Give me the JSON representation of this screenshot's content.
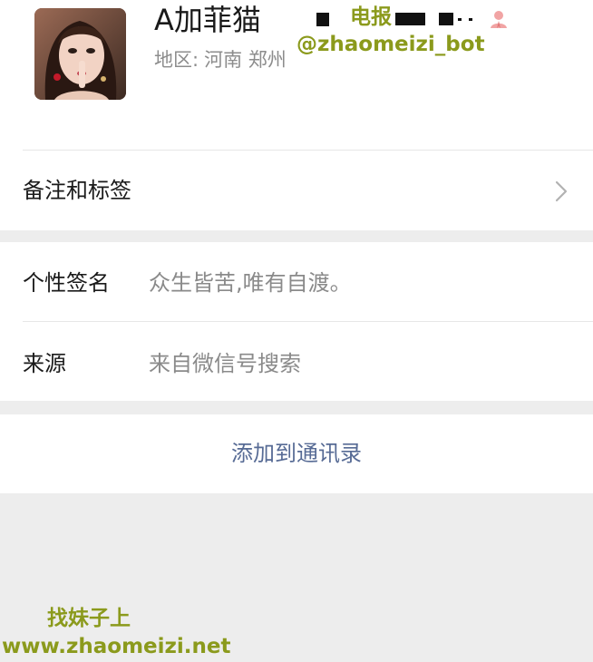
{
  "profile": {
    "name": "A加菲猫",
    "region_label": "地区:",
    "region_value": "河南 郑州"
  },
  "watermark": {
    "telegram": "电报",
    "handle": "@zhaomeizi_bot",
    "site_cn": "找妹子上",
    "site": "www.zhaomeizi.net"
  },
  "rows": {
    "remarks_label": "备注和标签",
    "signature_label": "个性签名",
    "signature_value": "众生皆苦,唯有自渡。",
    "source_label": "来源",
    "source_value": "来自微信号搜索"
  },
  "actions": {
    "add_contact": "添加到通讯录"
  },
  "colors": {
    "link": "#576b95",
    "background": "#ededed",
    "watermark": "#8b9a1c"
  }
}
